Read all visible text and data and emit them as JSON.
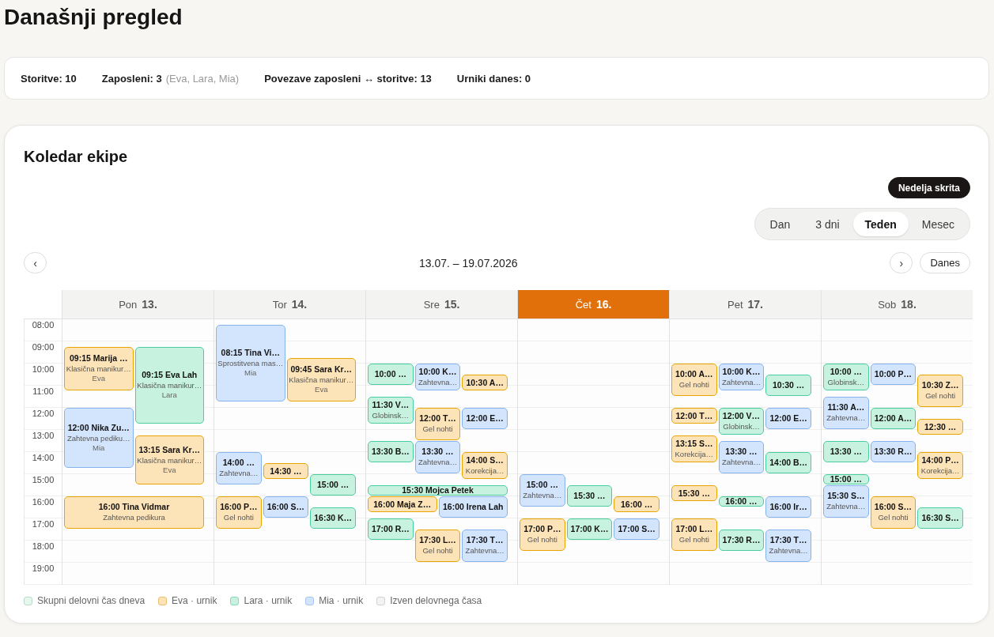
{
  "page_title": "Današnji pregled",
  "stats": [
    {
      "text": "Storitve: 10"
    },
    {
      "text": "Zaposleni: 3",
      "note": "(Eva, Lara, Mia)"
    },
    {
      "text": "Povezave zaposleni ↔ storitve: 13"
    },
    {
      "text": "Urniki danes: 0"
    }
  ],
  "calendar": {
    "title": "Koledar ekipe",
    "sunday_toggle": {
      "label": "Nedelja skrita",
      "on": true
    },
    "views": [
      {
        "label": "Dan",
        "selected": false
      },
      {
        "label": "3 dni",
        "selected": false
      },
      {
        "label": "Teden",
        "selected": true
      },
      {
        "label": "Mesec",
        "selected": false
      }
    ],
    "prev": "‹",
    "range": "13.07. – 19.07.2026",
    "next": "›",
    "today_button": "Danes",
    "hours": [
      "08:00",
      "09:00",
      "10:00",
      "11:00",
      "12:00",
      "13:00",
      "14:00",
      "15:00",
      "16:00",
      "17:00",
      "18:00",
      "19:00"
    ],
    "days": [
      {
        "name": "Pon",
        "date": "13.",
        "today": false,
        "events": [
          {
            "time": "09:15",
            "client": "Marija …",
            "service": "Klasična manikur…",
            "staff": "Eva",
            "kind": "min120",
            "color": "#fde3b8"
          },
          {
            "time": "09:15",
            "client": "Eva Lah",
            "service": "Klasična manikur…",
            "staff": "Lara",
            "kind": "min210",
            "color": "#c7f2df"
          },
          {
            "time": "12:00",
            "client": "Nika Zu…",
            "service": "Zahtevna pediku…",
            "staff": "Mia",
            "kind": "min165",
            "color": "#d3e5fd"
          },
          {
            "time": "13:15",
            "client": "Sara Kr…",
            "service": "Klasična manikur…",
            "staff": "Eva",
            "kind": "min135",
            "color": "#fde3b8"
          },
          {
            "time": "16:00",
            "client": "Tina Vidmar",
            "service": "Zahtevna pedikura",
            "kind": "min90",
            "color": "#fde3b8"
          }
        ]
      },
      {
        "name": "Tor",
        "date": "14.",
        "today": false,
        "events": [
          {
            "time": "08:15",
            "client": "Tina Vi…",
            "service": "Sprostitvena mas…",
            "staff": "Mia",
            "kind": "min210",
            "color": "#d3e5fd"
          },
          {
            "time": "09:45",
            "client": "Sara Kr…",
            "service": "Klasična manikur…",
            "staff": "Eva",
            "kind": "min120",
            "color": "#fde3b8"
          },
          {
            "time": "14:00",
            "client": "…",
            "service": "Zahtevna…",
            "kind": "min90",
            "color": "#d3e5fd"
          },
          {
            "time": "14:30",
            "client": "…",
            "kind": "min45",
            "color": "#fde3b8"
          },
          {
            "time": "15:00",
            "client": "…",
            "kind": "min60",
            "color": "#c7f2df"
          },
          {
            "time": "16:00",
            "client": "P…",
            "service": "Gel nohti",
            "kind": "min90",
            "color": "#fde3b8"
          },
          {
            "time": "16:00",
            "client": "S…",
            "kind": "min60",
            "color": "#d3e5fd"
          },
          {
            "time": "16:30",
            "client": "K…",
            "kind": "min60",
            "color": "#c7f2df"
          }
        ]
      },
      {
        "name": "Sre",
        "date": "15.",
        "today": false,
        "events": [
          {
            "time": "10:00",
            "client": "…",
            "kind": "min60",
            "color": "#c7f2df"
          },
          {
            "time": "10:00",
            "client": "K…",
            "service": "Zahtevna…",
            "kind": "min75",
            "color": "#d3e5fd"
          },
          {
            "time": "10:30",
            "client": "A…",
            "kind": "min45",
            "color": "#fde3b8"
          },
          {
            "time": "11:30",
            "client": "V…",
            "service": "Globinsk…",
            "kind": "min75",
            "color": "#c7f2df"
          },
          {
            "time": "12:00",
            "client": "T…",
            "service": "Gel nohti",
            "kind": "min90",
            "color": "#fde3b8"
          },
          {
            "time": "12:00",
            "client": "E…",
            "kind": "min60",
            "color": "#d3e5fd"
          },
          {
            "time": "13:30",
            "client": "B…",
            "kind": "min60",
            "color": "#c7f2df"
          },
          {
            "time": "13:30",
            "client": "…",
            "service": "Zahtevna…",
            "kind": "min90",
            "color": "#d3e5fd"
          },
          {
            "time": "14:00",
            "client": "S…",
            "service": "Korekcija…",
            "kind": "min75",
            "color": "#fde3b8"
          },
          {
            "time": "15:30",
            "client": "Mojca Petek",
            "kind": "min30",
            "color": "#c7f2df"
          },
          {
            "time": "16:00",
            "client": "Maja Z…",
            "kind": "min45",
            "color": "#fde3b8"
          },
          {
            "time": "16:00",
            "client": "Irena Lah",
            "kind": "min60",
            "color": "#d3e5fd"
          },
          {
            "time": "17:00",
            "client": "R…",
            "kind": "min60",
            "color": "#c7f2df"
          },
          {
            "time": "17:30",
            "client": "L…",
            "service": "Gel nohti",
            "kind": "min90",
            "color": "#fde3b8"
          },
          {
            "time": "17:30",
            "client": "T…",
            "service": "Zahtevna…",
            "kind": "min90",
            "color": "#d3e5fd"
          }
        ]
      },
      {
        "name": "Čet",
        "date": "16.",
        "today": true,
        "events": [
          {
            "time": "15:00",
            "client": "…",
            "service": "Zahtevna…",
            "kind": "min90",
            "color": "#d3e5fd"
          },
          {
            "time": "15:30",
            "client": "…",
            "kind": "min60",
            "color": "#c7f2df"
          },
          {
            "time": "16:00",
            "client": "…",
            "kind": "min45",
            "color": "#fde3b8"
          },
          {
            "time": "17:00",
            "client": "P…",
            "service": "Gel nohti",
            "kind": "min90",
            "color": "#fde3b8"
          },
          {
            "time": "17:00",
            "client": "K…",
            "kind": "min60",
            "color": "#c7f2df"
          },
          {
            "time": "17:00",
            "client": "S…",
            "kind": "min60",
            "color": "#d3e5fd"
          }
        ]
      },
      {
        "name": "Pet",
        "date": "17.",
        "today": false,
        "events": [
          {
            "time": "10:00",
            "client": "A…",
            "service": "Gel nohti",
            "kind": "min90",
            "color": "#fde3b8"
          },
          {
            "time": "10:00",
            "client": "K…",
            "service": "Zahtevna…",
            "kind": "min75",
            "color": "#d3e5fd"
          },
          {
            "time": "10:30",
            "client": "…",
            "kind": "min60",
            "color": "#c7f2df"
          },
          {
            "time": "12:00",
            "client": "T…",
            "kind": "min45",
            "color": "#fde3b8"
          },
          {
            "time": "12:00",
            "client": "V…",
            "service": "Globinsk…",
            "kind": "min75",
            "color": "#c7f2df"
          },
          {
            "time": "12:00",
            "client": "E…",
            "kind": "min60",
            "color": "#d3e5fd"
          },
          {
            "time": "13:15",
            "client": "S…",
            "service": "Korekcija…",
            "kind": "min75",
            "color": "#fde3b8"
          },
          {
            "time": "13:30",
            "client": "…",
            "service": "Zahtevna…",
            "kind": "min90",
            "color": "#d3e5fd"
          },
          {
            "time": "14:00",
            "client": "B…",
            "kind": "min60",
            "color": "#c7f2df"
          },
          {
            "time": "15:30",
            "client": "…",
            "kind": "min45",
            "color": "#fde3b8"
          },
          {
            "time": "16:00",
            "client": "…",
            "kind": "min30",
            "color": "#c7f2df"
          },
          {
            "time": "16:00",
            "client": "Ir…",
            "kind": "min60",
            "color": "#d3e5fd"
          },
          {
            "time": "17:00",
            "client": "L…",
            "service": "Gel nohti",
            "kind": "min90",
            "color": "#fde3b8"
          },
          {
            "time": "17:30",
            "client": "R…",
            "kind": "min60",
            "color": "#c7f2df"
          },
          {
            "time": "17:30",
            "client": "T…",
            "service": "Zahtevna…",
            "kind": "min90",
            "color": "#d3e5fd"
          }
        ]
      },
      {
        "name": "Sob",
        "date": "18.",
        "today": false,
        "events": [
          {
            "time": "10:00",
            "client": "…",
            "service": "Globinsk…",
            "kind": "min75",
            "color": "#c7f2df"
          },
          {
            "time": "10:00",
            "client": "P…",
            "kind": "min60",
            "color": "#d3e5fd"
          },
          {
            "time": "10:30",
            "client": "Z…",
            "service": "Gel nohti",
            "kind": "min90",
            "color": "#fde3b8"
          },
          {
            "time": "11:30",
            "client": "A…",
            "service": "Zahtevna…",
            "kind": "min90",
            "color": "#d3e5fd"
          },
          {
            "time": "12:00",
            "client": "A…",
            "kind": "min60",
            "color": "#c7f2df"
          },
          {
            "time": "12:30",
            "client": "…",
            "kind": "min45",
            "color": "#fde3b8"
          },
          {
            "time": "13:30",
            "client": "…",
            "kind": "min60",
            "color": "#c7f2df"
          },
          {
            "time": "13:30",
            "client": "R…",
            "kind": "min60",
            "color": "#d3e5fd"
          },
          {
            "time": "14:00",
            "client": "P…",
            "service": "Korekcija…",
            "kind": "min75",
            "color": "#fde3b8"
          },
          {
            "time": "15:00",
            "client": "…",
            "kind": "min30",
            "color": "#c7f2df"
          },
          {
            "time": "15:30",
            "client": "S…",
            "service": "Zahtevna…",
            "kind": "min90",
            "color": "#d3e5fd"
          },
          {
            "time": "16:00",
            "client": "S…",
            "service": "Gel nohti",
            "kind": "min90",
            "color": "#fde3b8"
          },
          {
            "time": "16:30",
            "client": "S…",
            "kind": "min60",
            "color": "#c7f2df"
          }
        ]
      }
    ],
    "legend": [
      {
        "label": "Skupni delovni čas dneva",
        "color": "#e6f8ee"
      },
      {
        "label": "Eva · urnik",
        "color": "#fde3b8"
      },
      {
        "label": "Lara · urnik",
        "color": "#c7f2df"
      },
      {
        "label": "Mia · urnik",
        "color": "#d3e5fd"
      },
      {
        "label": "Izven delovnega časa",
        "color": "#f3f3f3"
      }
    ]
  }
}
